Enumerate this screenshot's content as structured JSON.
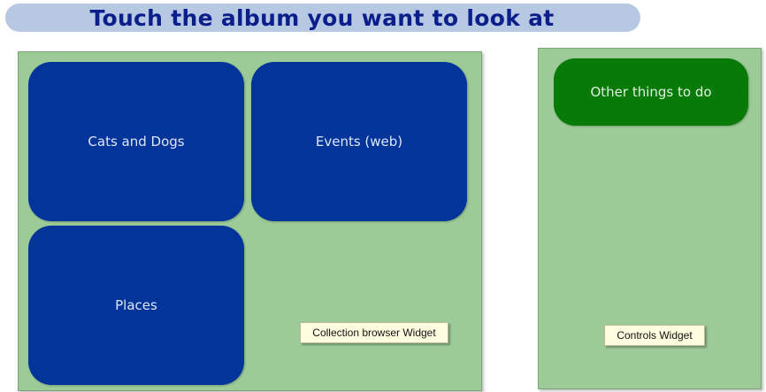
{
  "header": {
    "title": "Touch the album you want to look at"
  },
  "collection_browser": {
    "albums": [
      {
        "label": "Cats and Dogs"
      },
      {
        "label": "Events (web)"
      },
      {
        "label": "Places"
      }
    ],
    "widget_label": "Collection browser Widget"
  },
  "controls": {
    "other_button_label": "Other things to do",
    "widget_label": "Controls Widget"
  },
  "colors": {
    "album_blue": "#023499",
    "action_green": "#087a08",
    "panel_green": "#9ccb98",
    "title_bar": "#b7c8e3"
  }
}
